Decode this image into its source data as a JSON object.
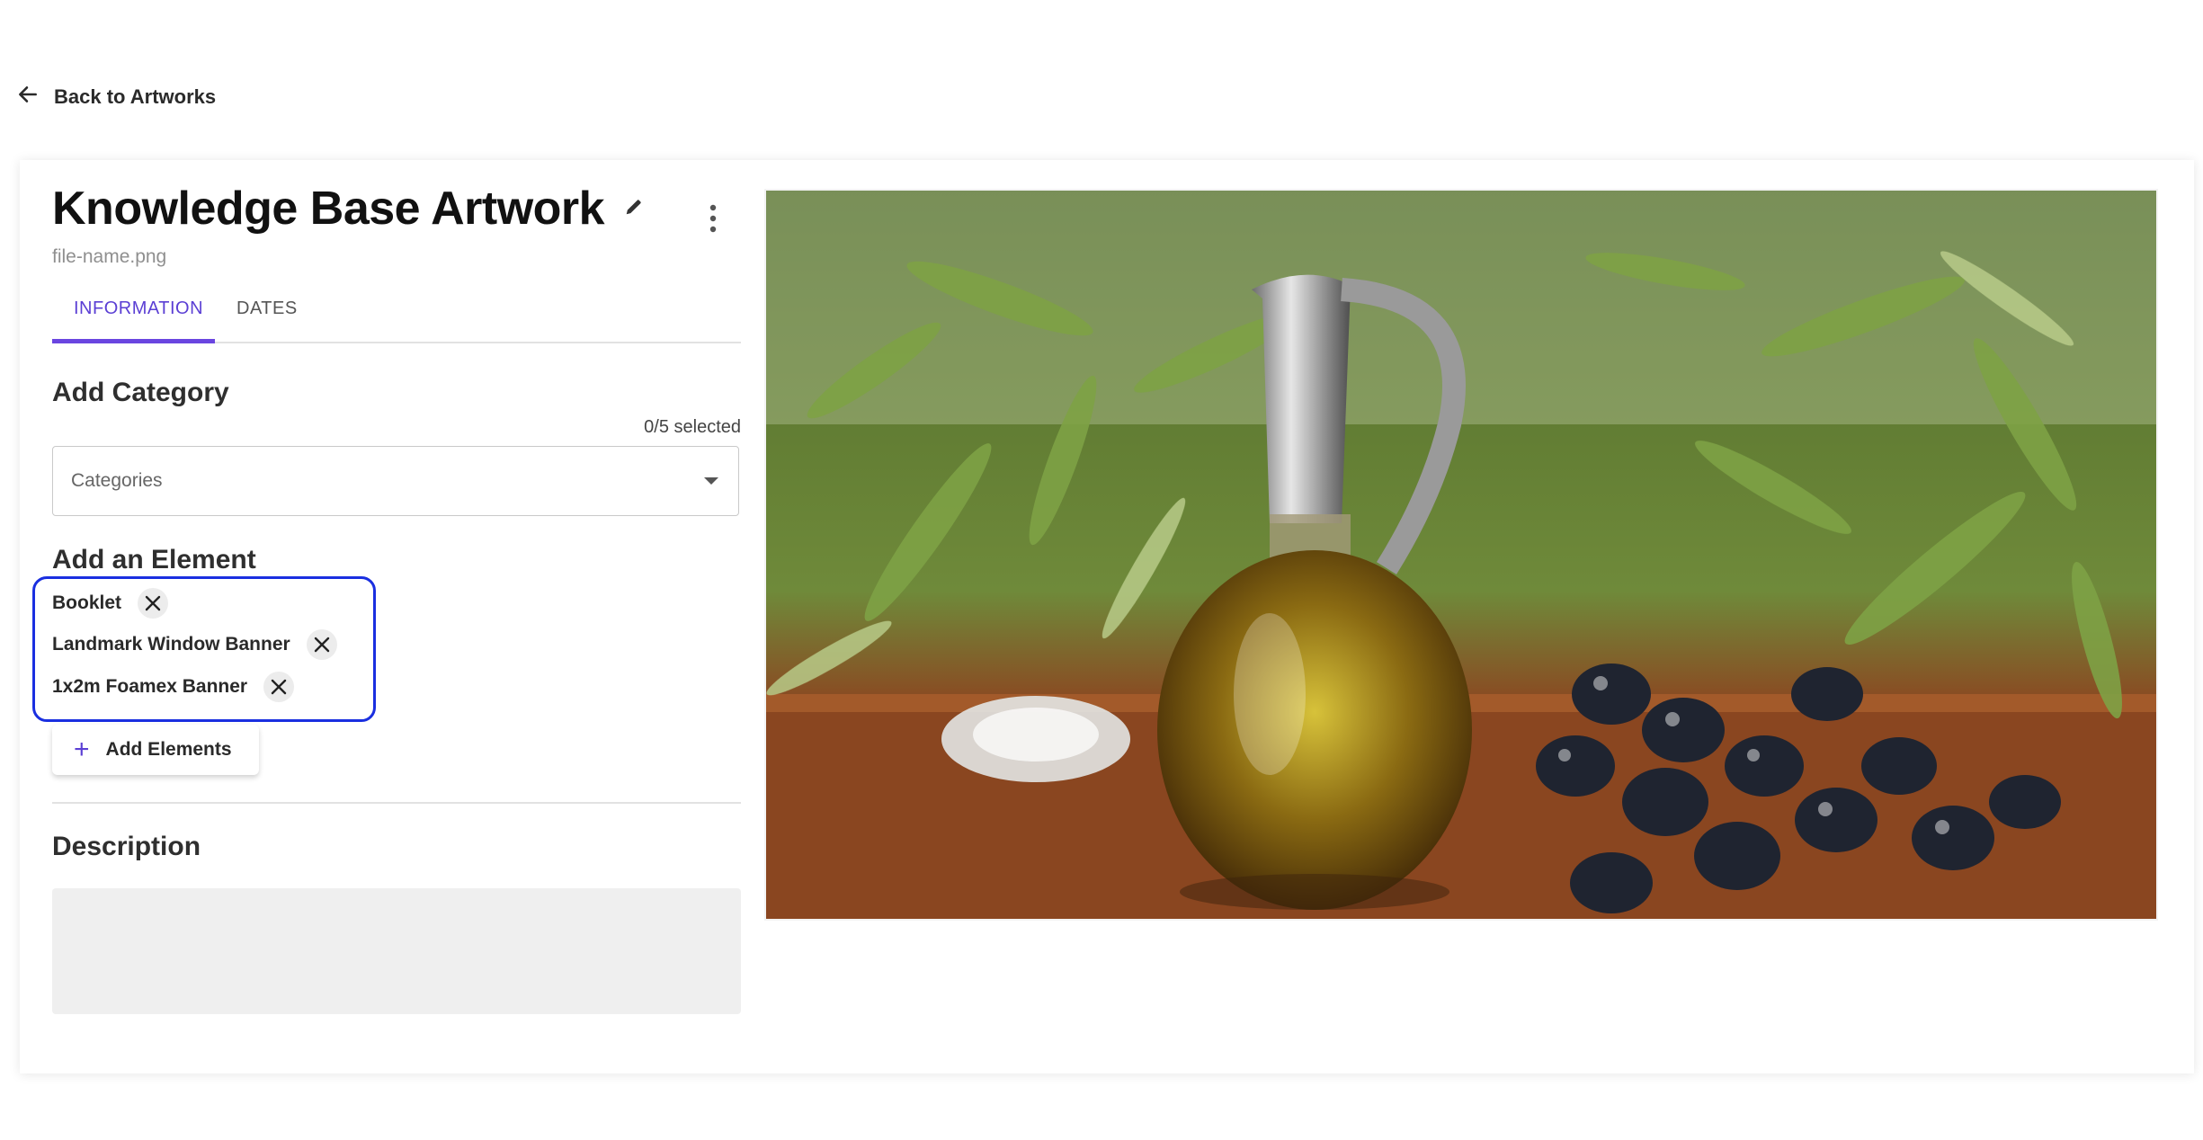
{
  "nav": {
    "back_label": "Back to Artworks"
  },
  "artwork": {
    "title": "Knowledge Base Artwork",
    "filename": "file-name.png"
  },
  "tabs": [
    {
      "label": "INFORMATION",
      "active": true
    },
    {
      "label": "DATES",
      "active": false
    }
  ],
  "category": {
    "heading": "Add Category",
    "selected_count": "0/5 selected",
    "placeholder": "Categories"
  },
  "elements": {
    "heading": "Add an Element",
    "items": [
      {
        "label": "Booklet"
      },
      {
        "label": "Landmark Window Banner"
      },
      {
        "label": "1x2m Foamex Banner"
      }
    ],
    "add_label": "Add Elements"
  },
  "description": {
    "heading": "Description",
    "value": ""
  },
  "colors": {
    "accent": "#5b3fd4",
    "highlight_border": "#1a2fe0"
  }
}
